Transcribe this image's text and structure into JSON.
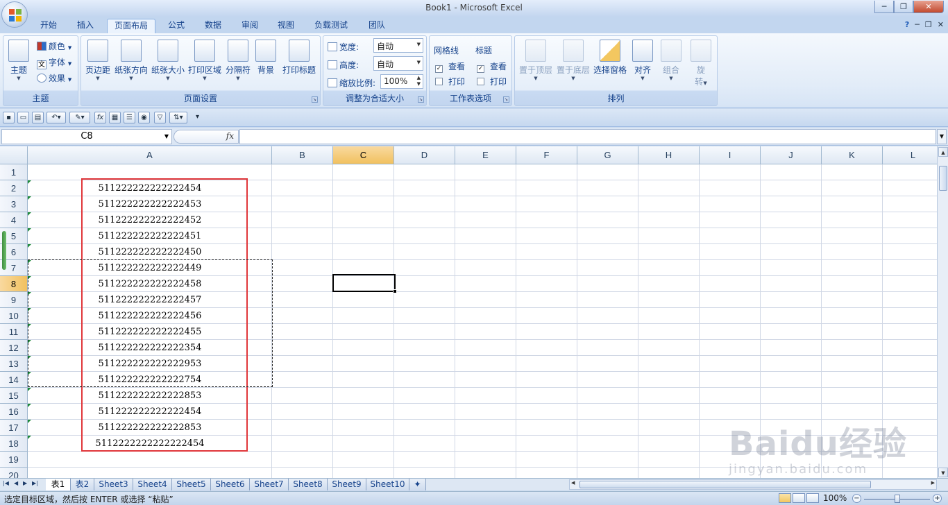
{
  "window": {
    "title": "Book1 - Microsoft Excel",
    "min": "─",
    "restore": "❐",
    "close": "✕"
  },
  "tabs": [
    "开始",
    "插入",
    "页面布局",
    "公式",
    "数据",
    "审阅",
    "视图",
    "负载测试",
    "团队"
  ],
  "active_tab": "页面布局",
  "ribbon": {
    "theme": {
      "name": "主题",
      "theme_btn": "主题",
      "colors": "颜色",
      "fonts": "字体",
      "effects": "效果",
      "fonts_icon_char": "文"
    },
    "page_setup": {
      "name": "页面设置",
      "buttons": [
        "页边距",
        "纸张方向",
        "纸张大小",
        "打印区域",
        "分隔符",
        "背景",
        "打印标题"
      ]
    },
    "scale": {
      "name": "调整为合适大小",
      "width_label": "宽度:",
      "width_value": "自动",
      "height_label": "高度:",
      "height_value": "自动",
      "zoom_label": "缩放比例:",
      "zoom_value": "100%"
    },
    "sheet_options": {
      "name": "工作表选项",
      "gridlines": "网格线",
      "headings": "标题",
      "view": "查看",
      "print": "打印"
    },
    "arrange": {
      "name": "排列",
      "buttons": [
        "置于顶层",
        "置于底层",
        "选择窗格",
        "对齐",
        "组合"
      ],
      "rotate_line1": "旋",
      "rotate_line2": "转"
    }
  },
  "formula_bar": {
    "name_box": "C8",
    "fx": "fx",
    "formula": ""
  },
  "columns": [
    "A",
    "B",
    "C",
    "D",
    "E",
    "F",
    "G",
    "H",
    "I",
    "J",
    "K",
    "L"
  ],
  "selected_column": "C",
  "rows": [
    "1",
    "2",
    "3",
    "4",
    "5",
    "6",
    "7",
    "8",
    "9",
    "10",
    "11",
    "12",
    "13",
    "14",
    "15",
    "16",
    "17",
    "18",
    "19",
    "20"
  ],
  "selected_row": "8",
  "cells_A": [
    "",
    "511222222222222454",
    "511222222222222453",
    "511222222222222452",
    "511222222222222451",
    "511222222222222450",
    "511222222222222449",
    "511222222222222458",
    "511222222222222457",
    "511222222222222456",
    "511222222222222455",
    "511222222222222354",
    "511222222222222953",
    "511222222222222754",
    "511222222222222853",
    "511222222222222454",
    "511222222222222853",
    "5112222222222222454"
  ],
  "sheet_tabs": [
    "表1",
    "表2",
    "Sheet3",
    "Sheet4",
    "Sheet5",
    "Sheet6",
    "Sheet7",
    "Sheet8",
    "Sheet9",
    "Sheet10"
  ],
  "active_sheet": "表1",
  "status": {
    "message": "选定目标区域，然后按 ENTER 或选择 “粘贴”",
    "zoom": "100%"
  },
  "watermark": {
    "brand": "Baidu经验",
    "url": "jingyan.baidu.com"
  },
  "colors": {
    "highlight_box": "#e0363a",
    "selected_header": "#f1c15f",
    "ribbon_text": "#15428b"
  }
}
